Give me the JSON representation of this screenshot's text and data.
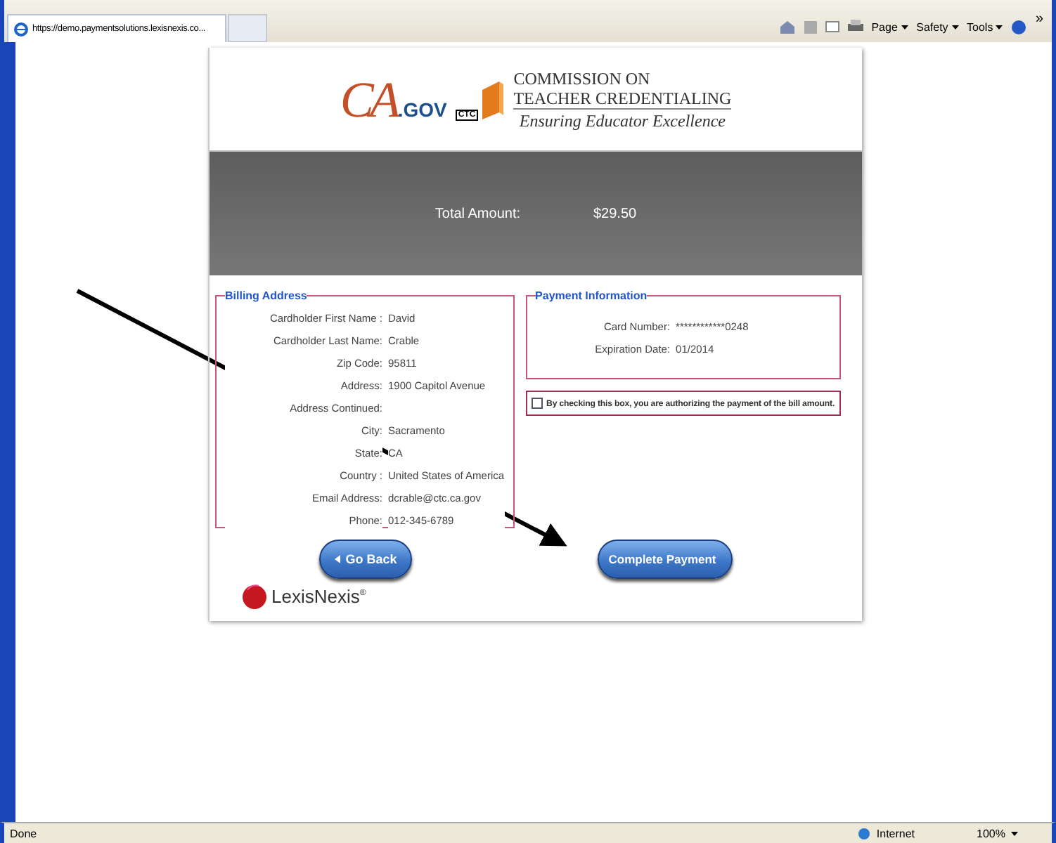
{
  "browser": {
    "tab_title": "https://demo.paymentsolutions.lexisnexis.co...",
    "menus": [
      {
        "label": "Page"
      },
      {
        "label": "Safety"
      },
      {
        "label": "Tools"
      }
    ],
    "overflow": "»"
  },
  "header": {
    "ca_logo": "CA",
    "ca_suffix": ".GOV",
    "ctc_badge": "CTC",
    "org_line1": "COMMISSION ON",
    "org_line2": "TEACHER CREDENTIALING",
    "tagline": "Ensuring Educator Excellence"
  },
  "total": {
    "label": "Total Amount:",
    "value": "$29.50"
  },
  "billing": {
    "legend": "Billing Address",
    "fields": [
      {
        "label": "Cardholder First Name :",
        "value": "David"
      },
      {
        "label": "Cardholder Last Name:",
        "value": "Crable"
      },
      {
        "label": "Zip Code:",
        "value": "95811"
      },
      {
        "label": "Address:",
        "value": "1900 Capitol Avenue"
      },
      {
        "label": "Address Continued:"
      },
      {
        "label": "City:",
        "value": "Sacramento"
      },
      {
        "label": "State:",
        "value": "CA"
      },
      {
        "label": "Country :",
        "value": "United States of America"
      },
      {
        "label": "Email Address:",
        "value": "dcrable@ctc.ca.gov"
      },
      {
        "label": "Phone:",
        "value": "012-345-6789"
      }
    ]
  },
  "payment": {
    "legend": "Payment Information",
    "fields": [
      {
        "label": "Card Number:",
        "value": "************0248"
      },
      {
        "label": "Expiration Date:",
        "value": "01/2014"
      }
    ]
  },
  "consent": {
    "label": "By checking this box, you are authorizing the payment of the bill amount.",
    "checked": false
  },
  "buttons": [
    {
      "label": "Go Back",
      "kind": "back"
    },
    {
      "label": "Complete Payment",
      "kind": "next"
    }
  ],
  "footer_logo": {
    "name": "LexisNexis",
    "mark": "®"
  },
  "status_bar": {
    "status": "Done",
    "zone": "Internet",
    "zoom": "100%"
  }
}
